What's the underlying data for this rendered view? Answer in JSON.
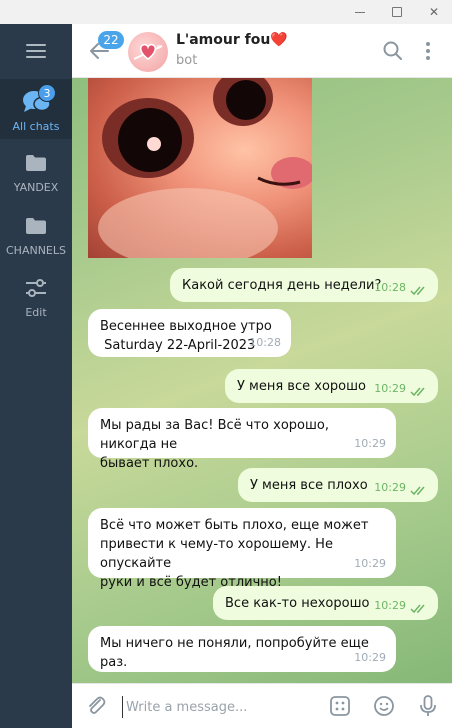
{
  "window": {
    "minimize": "",
    "maximize": "",
    "close": "✕"
  },
  "sidebar": {
    "folders": [
      {
        "label": "All chats",
        "badge": "3"
      },
      {
        "label": "YANDEX"
      },
      {
        "label": "CHANNELS"
      },
      {
        "label": "Edit"
      }
    ]
  },
  "header": {
    "unread_count": "22",
    "title": "L'amour fou❤️",
    "subtitle": "bot"
  },
  "messages": [
    {
      "direction": "out",
      "text": "Какой сегодня день недели?",
      "time": "10:28"
    },
    {
      "direction": "in",
      "lines": [
        "Весеннее выходное утро",
        " Saturday 22-April-2023"
      ],
      "time": "10:28"
    },
    {
      "direction": "out",
      "text": "У меня все хорошо",
      "time": "10:29"
    },
    {
      "direction": "in",
      "lines": [
        "Мы рады за Вас! Всё что хорошо, никогда не",
        "бывает плохо."
      ],
      "time": "10:29"
    },
    {
      "direction": "out",
      "text": "У меня все плохо",
      "time": "10:29"
    },
    {
      "direction": "in",
      "lines": [
        "Всё что может быть плохо, еще может",
        "привести к чему-то хорошему. Не опускайте",
        "руки и всё будет отлично!"
      ],
      "time": "10:29"
    },
    {
      "direction": "out",
      "text": "Все как-то нехорошо",
      "time": "10:29"
    },
    {
      "direction": "in",
      "lines": [
        "Мы ничего не поняли, попробуйте еще раз."
      ],
      "time": "10:29"
    }
  ],
  "composer": {
    "placeholder": "Write a message..."
  },
  "colors": {
    "sidebar": "#2b3a4b",
    "accent": "#4aa4e9",
    "outgoing_bubble": "#effdde",
    "read_ticks": "#6db565"
  }
}
